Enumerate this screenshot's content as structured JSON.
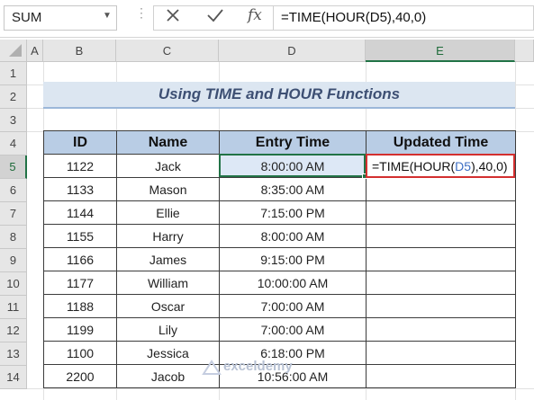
{
  "formula_bar": {
    "name_box": "SUM",
    "formula": "=TIME(HOUR(D5),40,0)"
  },
  "columns": [
    "A",
    "B",
    "C",
    "D",
    "E"
  ],
  "rows": [
    "1",
    "2",
    "3",
    "4",
    "5",
    "6",
    "7",
    "8",
    "9",
    "10",
    "11",
    "12",
    "13",
    "14"
  ],
  "title": "Using TIME and HOUR Functions",
  "table": {
    "headers": [
      "ID",
      "Name",
      "Entry Time",
      "Updated Time"
    ],
    "rows": [
      [
        "1122",
        "Jack",
        "8:00:00 AM",
        ""
      ],
      [
        "1133",
        "Mason",
        "8:35:00 AM",
        ""
      ],
      [
        "1144",
        "Ellie",
        "7:15:00 PM",
        ""
      ],
      [
        "1155",
        "Harry",
        "8:00:00 AM",
        ""
      ],
      [
        "1166",
        "James",
        "9:15:00 PM",
        ""
      ],
      [
        "1177",
        "William",
        "10:00:00 AM",
        ""
      ],
      [
        "1188",
        "Oscar",
        "7:00:00 AM",
        ""
      ],
      [
        "1199",
        "Lily",
        "7:00:00 AM",
        ""
      ],
      [
        "1100",
        "Jessica",
        "6:18:00 PM",
        ""
      ],
      [
        "2200",
        "Jacob",
        "10:56:00 AM",
        ""
      ]
    ]
  },
  "edit_cell": {
    "prefix": "=TIME(HOUR(",
    "ref": "D5",
    "suffix": "),40,0)"
  },
  "watermark": "exceldemy",
  "colors": {
    "accent": "#217346",
    "highlight_border": "#d32f2f",
    "header_fill": "#b9cde5",
    "title_fill": "#dce6f1"
  }
}
